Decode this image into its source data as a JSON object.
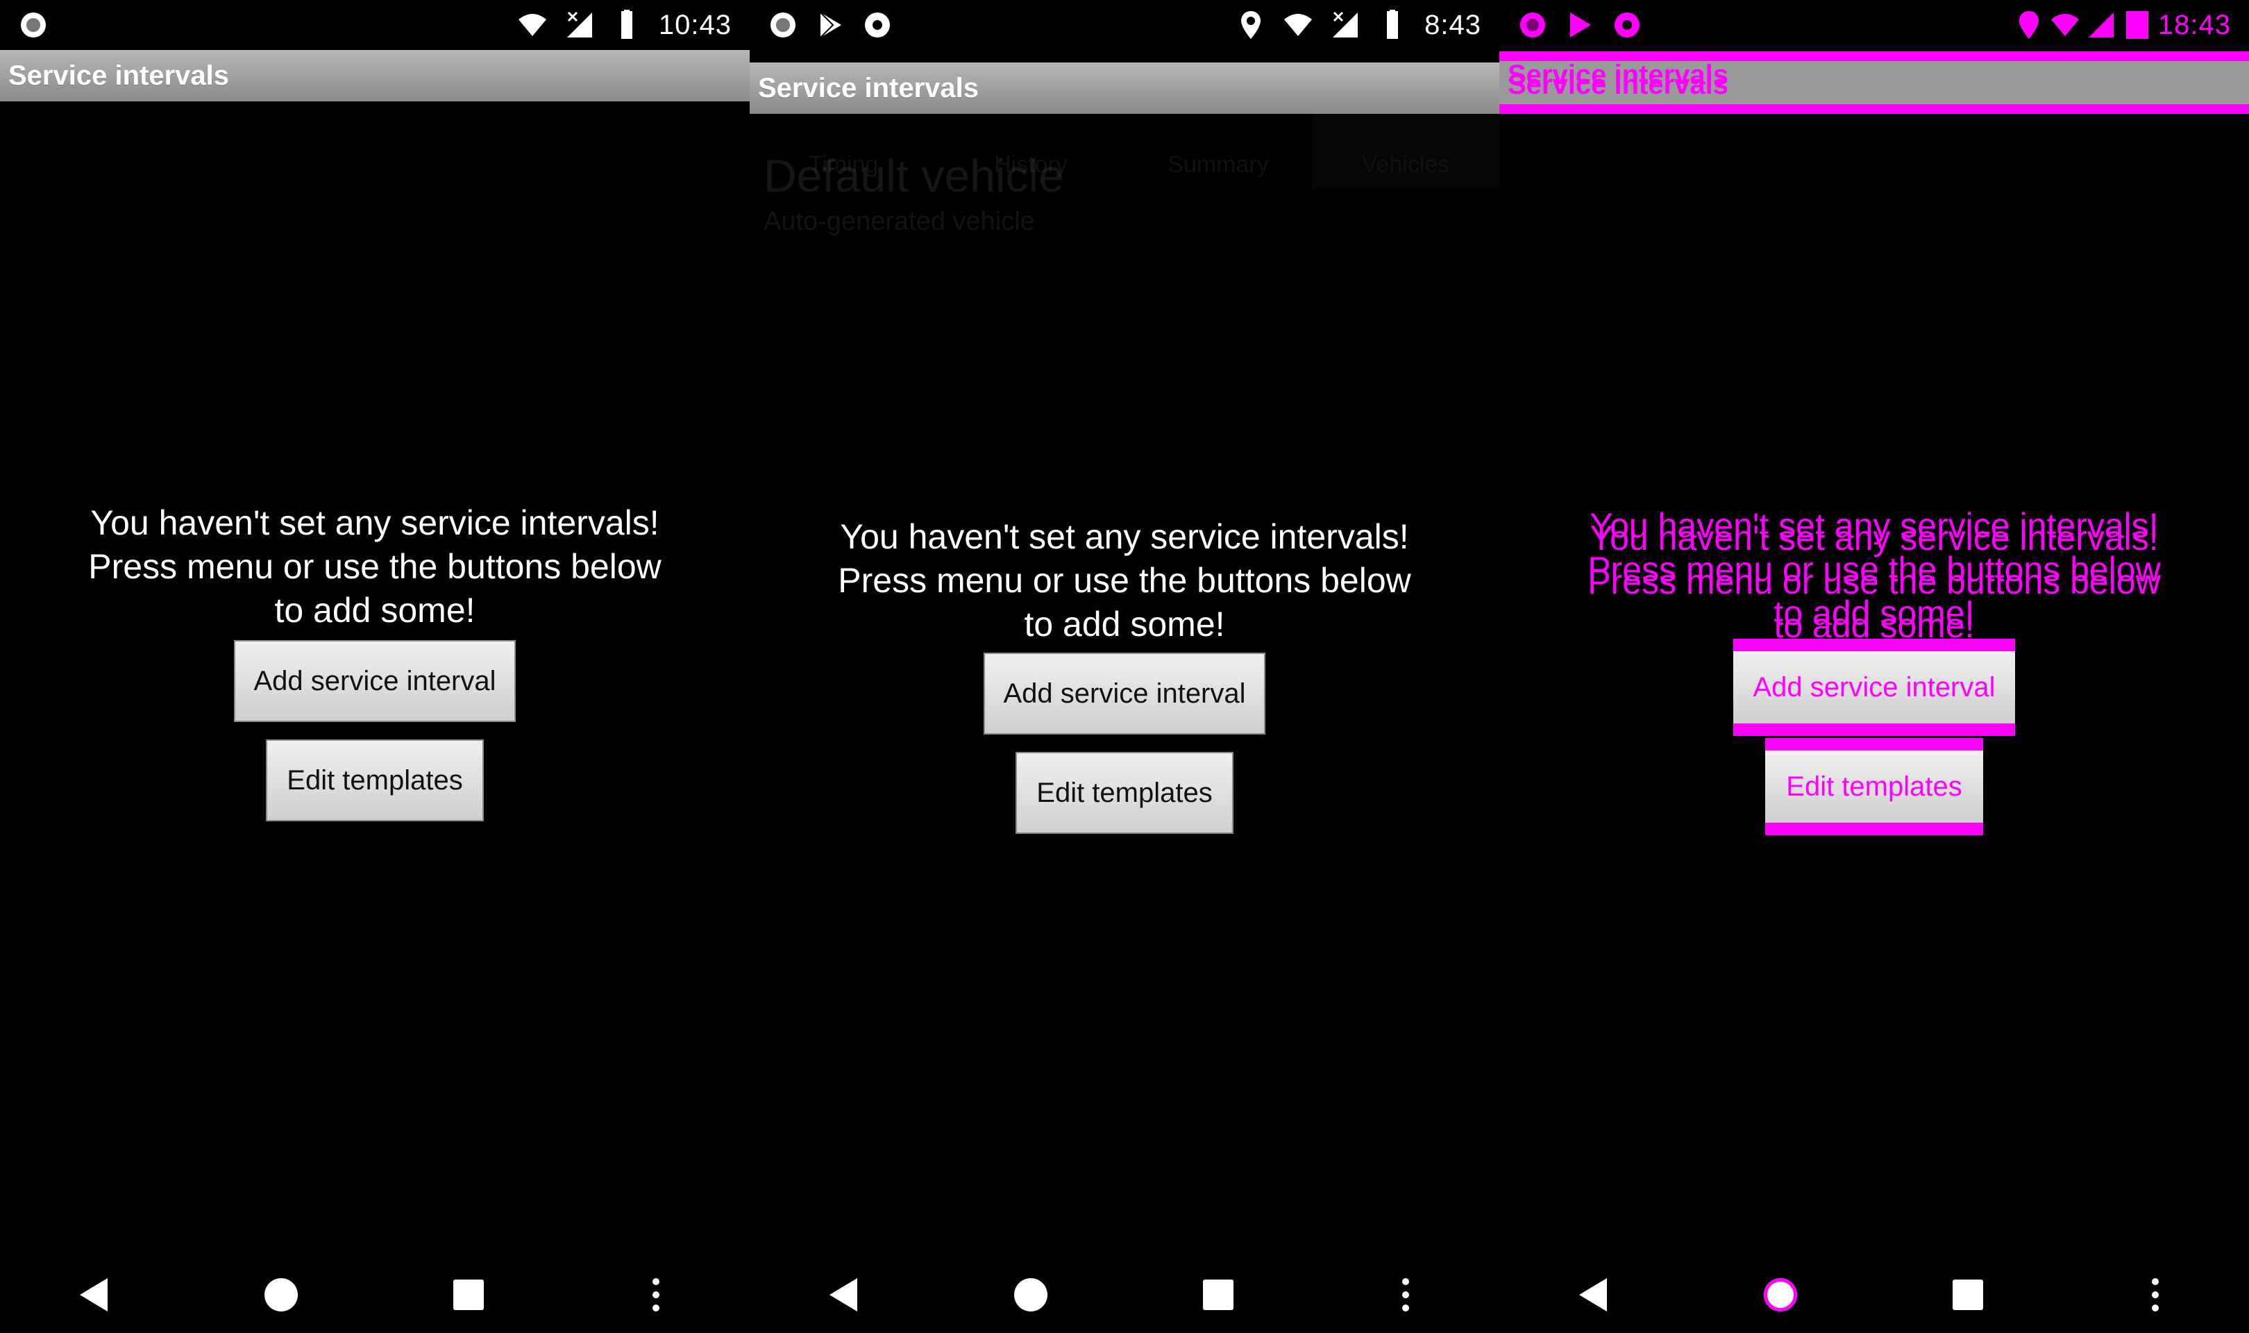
{
  "screens": [
    {
      "status": {
        "time": "10:43"
      },
      "title": "Service intervals",
      "message_lines": [
        "You haven't set any service intervals!",
        "Press menu or use the buttons below",
        "to add some!"
      ],
      "buttons": {
        "add": "Add service interval",
        "edit": "Edit templates"
      }
    },
    {
      "status": {
        "time": "8:43"
      },
      "title": "Service intervals",
      "message_lines": [
        "You haven't set any service intervals!",
        "Press menu or use the buttons below",
        "to add some!"
      ],
      "buttons": {
        "add": "Add service interval",
        "edit": "Edit templates"
      },
      "background_faded": {
        "tabs": [
          "Timing",
          "History",
          "Summary",
          "Vehicles"
        ],
        "vehicle_name": "Default vehicle",
        "vehicle_sub": "Auto-generated vehicle"
      }
    },
    {
      "status": {
        "time": "18:43"
      },
      "title": "Service intervals",
      "message_lines": [
        "You haven't set any service intervals!",
        "Press menu or use the buttons below",
        "to add some!"
      ],
      "buttons": {
        "add": "Add service interval",
        "edit": "Edit templates"
      }
    }
  ],
  "colors": {
    "highlight": "#ff00ff"
  }
}
